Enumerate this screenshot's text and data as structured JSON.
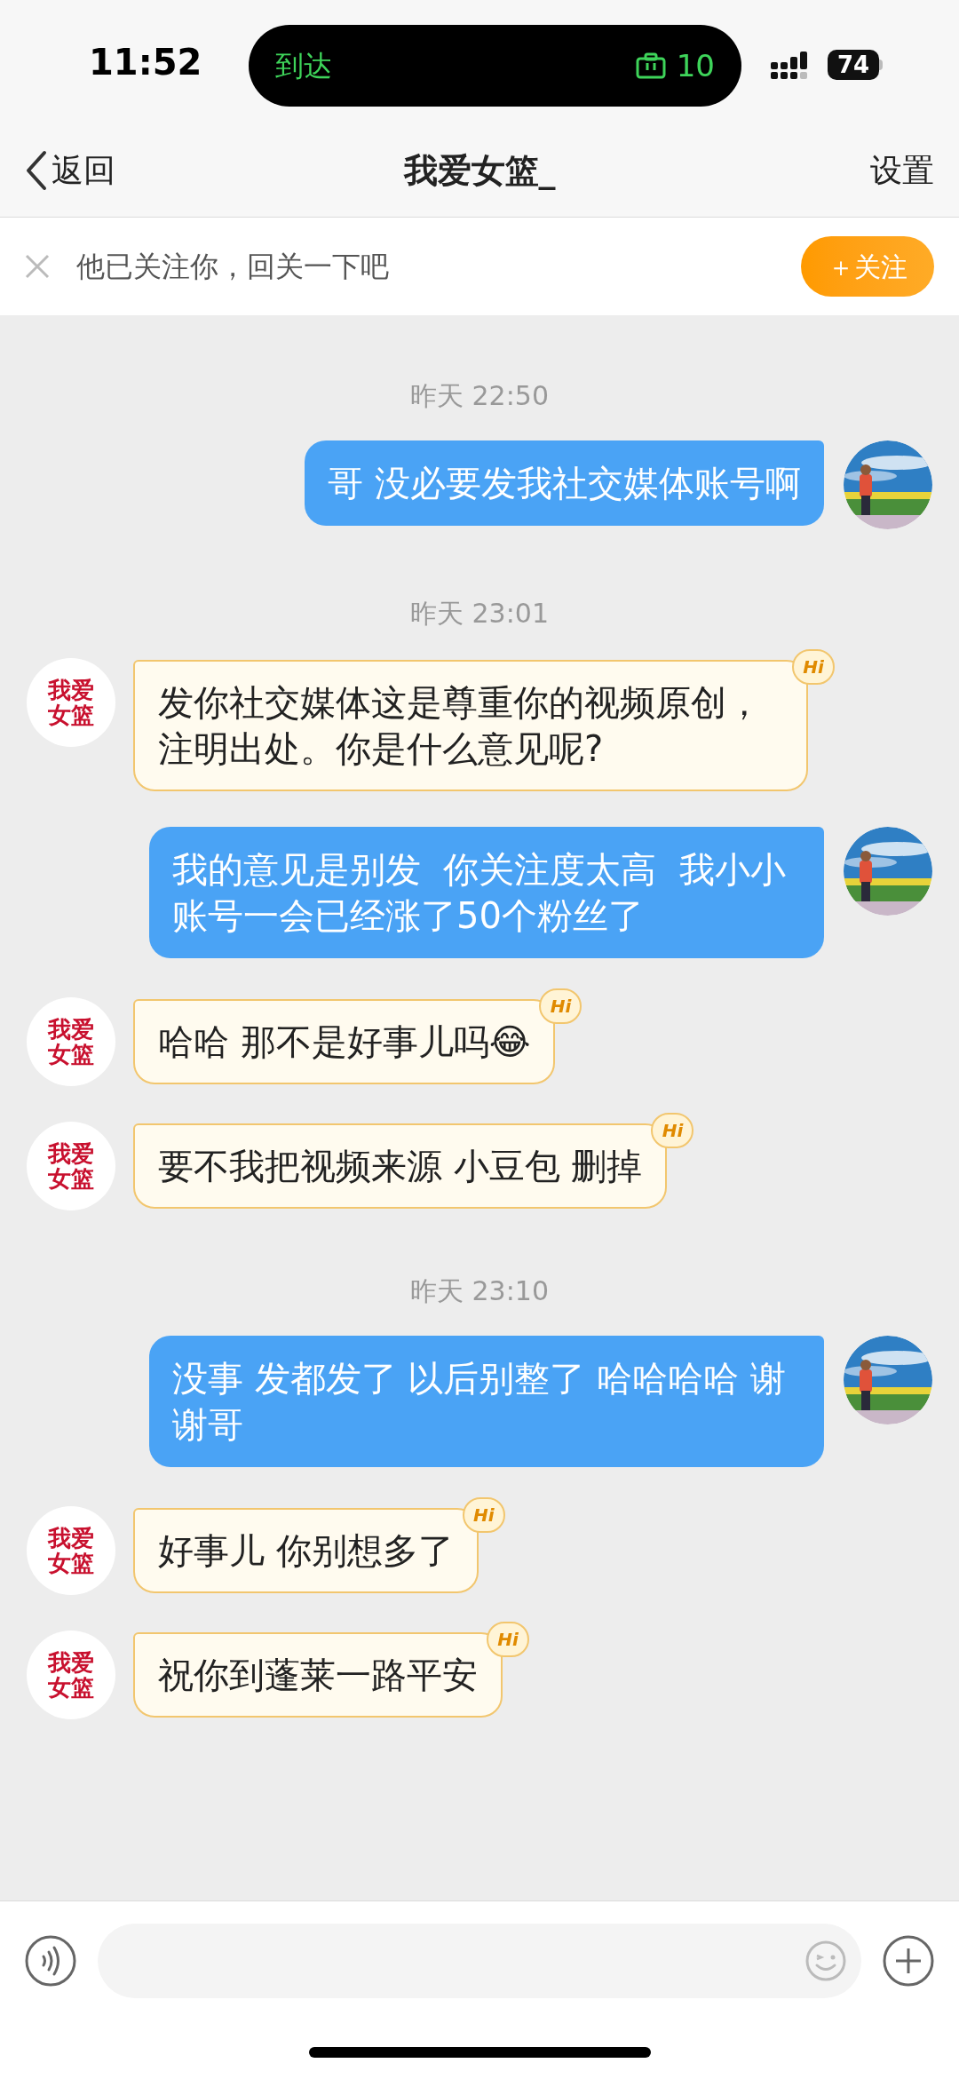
{
  "status_bar": {
    "time": "11:52",
    "island_label": "到达",
    "island_count": "10",
    "battery": "74"
  },
  "header": {
    "back": "返回",
    "title": "我爱女篮_",
    "settings": "设置"
  },
  "follow_bar": {
    "text": "他已关注你，回关一下吧",
    "button": "＋关注"
  },
  "messages": [
    {
      "kind": "time",
      "text": "昨天 22:50"
    },
    {
      "kind": "sent",
      "text": "哥 没必要发我社交媒体账号啊"
    },
    {
      "kind": "time",
      "text": "昨天 23:01"
    },
    {
      "kind": "received",
      "text": "发你社交媒体这是尊重你的视频原创，注明出处。你是什么意见呢?",
      "avatar_text": [
        "我爱",
        "女篮"
      ],
      "badge": "Hi"
    },
    {
      "kind": "sent",
      "text": "我的意见是别发  你关注度太高  我小小账号一会已经涨了50个粉丝了"
    },
    {
      "kind": "received",
      "text": "哈哈 那不是好事儿吗😂",
      "avatar_text": [
        "我爱",
        "女篮"
      ],
      "badge": "Hi"
    },
    {
      "kind": "received",
      "text": "要不我把视频来源 小豆包 删掉",
      "avatar_text": [
        "我爱",
        "女篮"
      ],
      "badge": "Hi"
    },
    {
      "kind": "time",
      "text": "昨天 23:10"
    },
    {
      "kind": "sent",
      "text": "没事 发都发了 以后别整了 哈哈哈哈 谢谢哥"
    },
    {
      "kind": "received",
      "text": "好事儿 你别想多了",
      "avatar_text": [
        "我爱",
        "女篮"
      ],
      "badge": "Hi"
    },
    {
      "kind": "received",
      "text": "祝你到蓬莱一路平安",
      "avatar_text": [
        "我爱",
        "女篮"
      ],
      "badge": "Hi"
    }
  ]
}
